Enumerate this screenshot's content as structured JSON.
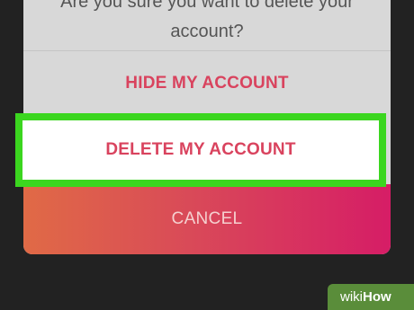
{
  "dialog": {
    "question": "Are you sure you want to delete your account?",
    "hide_label": "HIDE MY ACCOUNT",
    "delete_label": "DELETE MY ACCOUNT",
    "cancel_label": "CANCEL"
  },
  "watermark": {
    "wiki": "wiki",
    "how": "How"
  },
  "colors": {
    "highlight": "#3bd61f",
    "action_text": "#d9435e",
    "cancel_gradient_start": "#e06a46",
    "cancel_gradient_end": "#d61d66"
  }
}
